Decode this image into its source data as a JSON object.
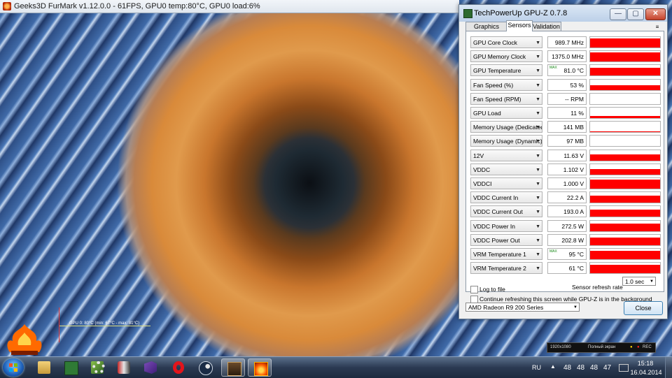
{
  "furmark": {
    "window_title": "Geeks3D FurMark v1.12.0.0 - 61FPS, GPU0 temp:80°C, GPU0 load:6%",
    "osd_text": "GPU 0: 80°C (min: 67°C - max: 81°C)",
    "capture_bar": {
      "resolution": "1920x1080",
      "mode": "Полный экран",
      "rec_label": "REC"
    }
  },
  "gpuz": {
    "title": "TechPowerUp GPU-Z 0.7.8",
    "window_buttons": {
      "minimize": "—",
      "maximize": "▢",
      "close": "✕"
    },
    "tabs": [
      {
        "label": "Graphics Card"
      },
      {
        "label": "Sensors"
      },
      {
        "label": "Validation"
      }
    ],
    "active_tab": "Sensors",
    "menu_icon": "≡",
    "sensors": [
      {
        "name": "GPU Core Clock",
        "value": "989.7 MHz",
        "max": "",
        "level": 0.85
      },
      {
        "name": "GPU Memory Clock",
        "value": "1375.0 MHz",
        "max": "",
        "level": 0.85
      },
      {
        "name": "GPU Temperature",
        "value": "81.0 °C",
        "max": "MAX",
        "level": 0.75
      },
      {
        "name": "Fan Speed (%)",
        "value": "53 %",
        "max": "",
        "level": 0.45
      },
      {
        "name": "Fan Speed (RPM)",
        "value": "-- RPM",
        "max": "",
        "level": 0.0
      },
      {
        "name": "GPU Load",
        "value": "11 %",
        "max": "",
        "level": 0.2
      },
      {
        "name": "Memory Usage (Dedicated)",
        "value": "141 MB",
        "max": "",
        "level": 0.05
      },
      {
        "name": "Memory Usage (Dynamic)",
        "value": "97 MB",
        "max": "",
        "level": 0.04
      },
      {
        "name": "12V",
        "value": "11.63 V",
        "max": "",
        "level": 0.6
      },
      {
        "name": "VDDC",
        "value": "1.102 V",
        "max": "",
        "level": 0.55
      },
      {
        "name": "VDDCI",
        "value": "1.000 V",
        "max": "",
        "level": 0.85
      },
      {
        "name": "VDDC Current In",
        "value": "22.2 A",
        "max": "",
        "level": 0.7
      },
      {
        "name": "VDDC Current Out",
        "value": "193.0 A",
        "max": "",
        "level": 0.7
      },
      {
        "name": "VDDC Power In",
        "value": "272.5 W",
        "max": "",
        "level": 0.7
      },
      {
        "name": "VDDC Power Out",
        "value": "202.8 W",
        "max": "",
        "level": 0.7
      },
      {
        "name": "VRM Temperature 1",
        "value": "95 °C",
        "max": "MAX",
        "level": 0.8
      },
      {
        "name": "VRM Temperature 2",
        "value": "61 °C",
        "max": "",
        "level": 0.8
      }
    ],
    "log_to_file_label": "Log to file",
    "log_to_file_checked": false,
    "refresh_rate_label": "Sensor refresh rate",
    "refresh_rate_value": "1.0 sec",
    "background_refresh_label": "Continue refreshing this screen while GPU-Z is in the background",
    "background_refresh_checked": false,
    "gpu_select": "AMD Radeon R9 200 Series",
    "close_label": "Close"
  },
  "taskbar": {
    "apps": [
      {
        "name": "user-folder-icon",
        "active": false
      },
      {
        "name": "gpuz-taskbar-icon",
        "active": false
      },
      {
        "name": "gpu-tool-icon",
        "active": false
      },
      {
        "name": "settings-gear-icon",
        "active": false
      },
      {
        "name": "msi-afterburner-icon",
        "active": false
      },
      {
        "name": "visual-studio-icon",
        "active": false
      },
      {
        "name": "opera-icon",
        "active": false
      },
      {
        "name": "steam-icon",
        "active": false
      },
      {
        "name": "game-launcher-icon",
        "active": true
      },
      {
        "name": "furmark-taskbar-icon",
        "active": true
      }
    ],
    "tray": {
      "language": "RU",
      "temps": [
        "48",
        "48",
        "48",
        "47"
      ]
    },
    "clock": {
      "time": "15:18",
      "date": "16.04.2014"
    }
  }
}
